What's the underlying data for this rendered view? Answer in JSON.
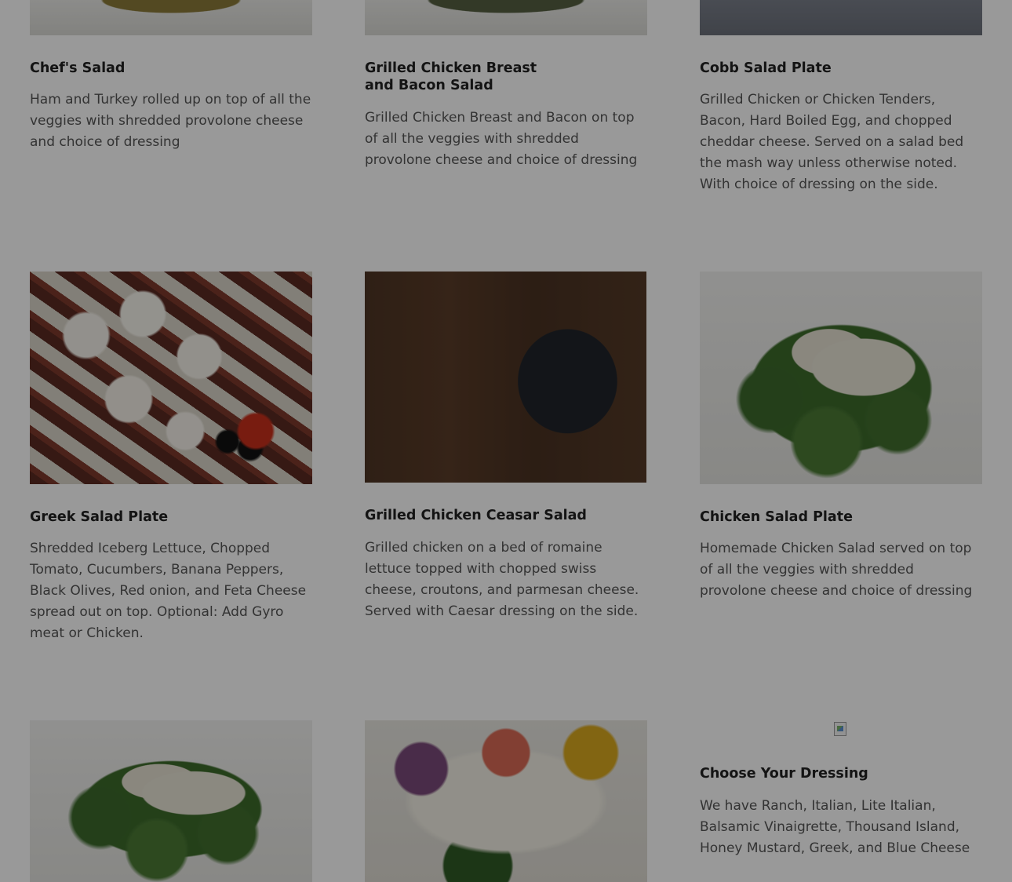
{
  "menu": {
    "items": [
      {
        "title": "Chef's Salad",
        "description": "Ham and Turkey rolled up on top of all the veggies with shredded provolone cheese and choice of dressing",
        "image": "salad-photo"
      },
      {
        "title": "Grilled Chicken Breast and Bacon Salad",
        "description": "Grilled Chicken Breast and Bacon on top of all the veggies with shredded provolone cheese and choice of dressing",
        "image": "salad-photo"
      },
      {
        "title": "Cobb Salad Plate",
        "description": "Grilled Chicken or Chicken Tenders, Bacon, Hard Boiled Egg, and chopped cheddar cheese. Served on a salad bed the mash way unless otherwise noted. With choice of dressing on the side.",
        "image": "salad-photo"
      },
      {
        "title": "Greek Salad Plate",
        "description": "Shredded Iceberg Lettuce, Chopped Tomato, Cucumbers, Banana Peppers, Black Olives, Red onion, and Feta Cheese spread out on top. Optional: Add Gyro meat or Chicken.",
        "image": "greek-salad-photo"
      },
      {
        "title": "Grilled Chicken Ceasar Salad",
        "description": "Grilled chicken on a bed of romaine lettuce topped with chopped swiss cheese, croutons, and parmesan cheese. Served with Caesar dressing on the side.",
        "image": "menu-coming-soon-photo"
      },
      {
        "title": "Chicken Salad Plate",
        "description": "Homemade Chicken Salad served on top of all the veggies with shredded provolone cheese and choice of dressing",
        "image": "salad-photo"
      },
      {
        "title": "",
        "description": "",
        "image": "salad-photo"
      },
      {
        "title": "",
        "description": "",
        "image": "salad-photo"
      },
      {
        "title": "Choose Your Dressing",
        "description": "We have Ranch, Italian, Lite Italian, Balsamic Vinaigrette, Thousand Island, Honey Mustard, Greek, and Blue Cheese",
        "image": "broken-image-icon"
      }
    ]
  },
  "modal_overlay": {
    "visible": true,
    "color": "#000000"
  }
}
